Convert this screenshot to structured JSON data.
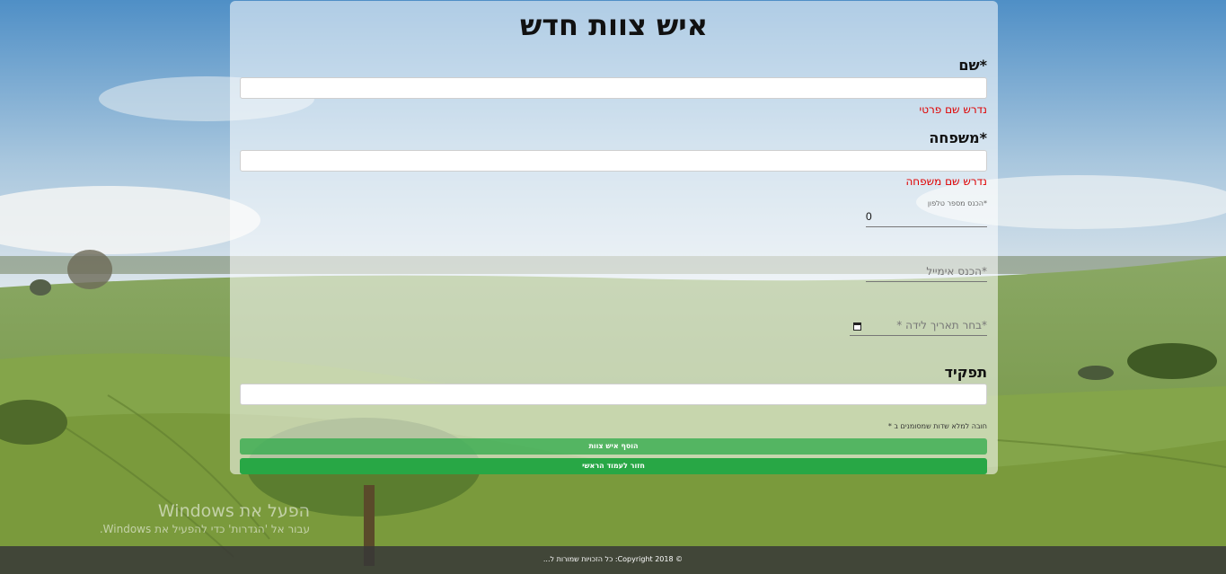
{
  "form": {
    "title": "איש צוות חדש",
    "first_name": {
      "label": "*שם",
      "value": "",
      "error": "נדרש שם פרטי"
    },
    "last_name": {
      "label": "*משפחה",
      "value": "",
      "error": "נדרש שם משפחה"
    },
    "phone": {
      "label": "*הכנס מספר טלפון",
      "value": "0"
    },
    "email": {
      "placeholder": "*הכנס אימייל"
    },
    "birth_date": {
      "placeholder": "*בחר תאריך לידה *"
    },
    "role": {
      "label": "תפקיד",
      "value": ""
    },
    "required_note": "חובה למלא שדות שמסומנים ב *",
    "add_button": "הוסף איש צוות",
    "back_button": "חזור לעמוד הראשי"
  },
  "windows_watermark": {
    "line1": "הפעל את Windows",
    "line2": "עבור אל 'הגדרות' כדי להפעיל את Windows."
  },
  "footer": {
    "text": "© 2018 Copyright: כל הזכויות שמורות ל..."
  }
}
